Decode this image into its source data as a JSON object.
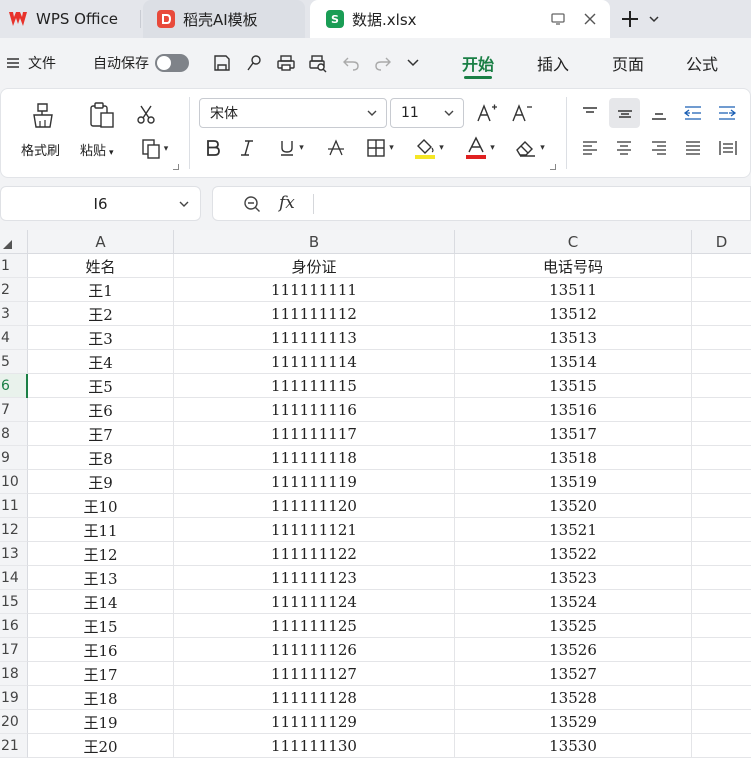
{
  "tabs": [
    {
      "label": "WPS Office",
      "icon": "wps-logo-icon",
      "state": "inactive"
    },
    {
      "label": "稻壳AI模板",
      "icon": "docer-icon",
      "state": "inactive"
    },
    {
      "label": "数据.xlsx",
      "icon": "spreadsheet-s-icon",
      "icon_text": "S",
      "state": "active"
    }
  ],
  "menu": {
    "file_label": "文件",
    "autosave_label": "自动保存",
    "autosave_on": false,
    "tabs": [
      "开始",
      "插入",
      "页面",
      "公式"
    ],
    "active_tab": "开始"
  },
  "ribbon": {
    "format_painter_label": "格式刷",
    "paste_label": "粘贴",
    "font_name": "宋体",
    "font_size": "11"
  },
  "formula_bar": {
    "cell_ref": "I6",
    "fx_label": "fx",
    "content": ""
  },
  "sheet": {
    "columns": [
      "A",
      "B",
      "C",
      "D"
    ],
    "selected_row": 6,
    "rows": [
      {
        "n": "1",
        "cells": [
          "姓名",
          "身份证",
          "电话号码"
        ]
      },
      {
        "n": "2",
        "cells": [
          "王1",
          "111111111",
          "13511"
        ]
      },
      {
        "n": "3",
        "cells": [
          "王2",
          "111111112",
          "13512"
        ]
      },
      {
        "n": "4",
        "cells": [
          "王3",
          "111111113",
          "13513"
        ]
      },
      {
        "n": "5",
        "cells": [
          "王4",
          "111111114",
          "13514"
        ]
      },
      {
        "n": "6",
        "cells": [
          "王5",
          "111111115",
          "13515"
        ]
      },
      {
        "n": "7",
        "cells": [
          "王6",
          "111111116",
          "13516"
        ]
      },
      {
        "n": "8",
        "cells": [
          "王7",
          "111111117",
          "13517"
        ]
      },
      {
        "n": "9",
        "cells": [
          "王8",
          "111111118",
          "13518"
        ]
      },
      {
        "n": "10",
        "cells": [
          "王9",
          "111111119",
          "13519"
        ]
      },
      {
        "n": "11",
        "cells": [
          "王10",
          "111111120",
          "13520"
        ]
      },
      {
        "n": "12",
        "cells": [
          "王11",
          "111111121",
          "13521"
        ]
      },
      {
        "n": "13",
        "cells": [
          "王12",
          "111111122",
          "13522"
        ]
      },
      {
        "n": "14",
        "cells": [
          "王13",
          "111111123",
          "13523"
        ]
      },
      {
        "n": "15",
        "cells": [
          "王14",
          "111111124",
          "13524"
        ]
      },
      {
        "n": "16",
        "cells": [
          "王15",
          "111111125",
          "13525"
        ]
      },
      {
        "n": "17",
        "cells": [
          "王16",
          "111111126",
          "13526"
        ]
      },
      {
        "n": "18",
        "cells": [
          "王17",
          "111111127",
          "13527"
        ]
      },
      {
        "n": "19",
        "cells": [
          "王18",
          "111111128",
          "13528"
        ]
      },
      {
        "n": "20",
        "cells": [
          "王19",
          "111111129",
          "13529"
        ]
      },
      {
        "n": "21",
        "cells": [
          "王20",
          "111111130",
          "13530"
        ]
      }
    ]
  },
  "colors": {
    "accent_green": "#1a7f45",
    "wps_red": "#e8322b",
    "docer_red": "#e84a3b",
    "fill_yellow": "#f5e625",
    "font_red": "#e02020"
  }
}
